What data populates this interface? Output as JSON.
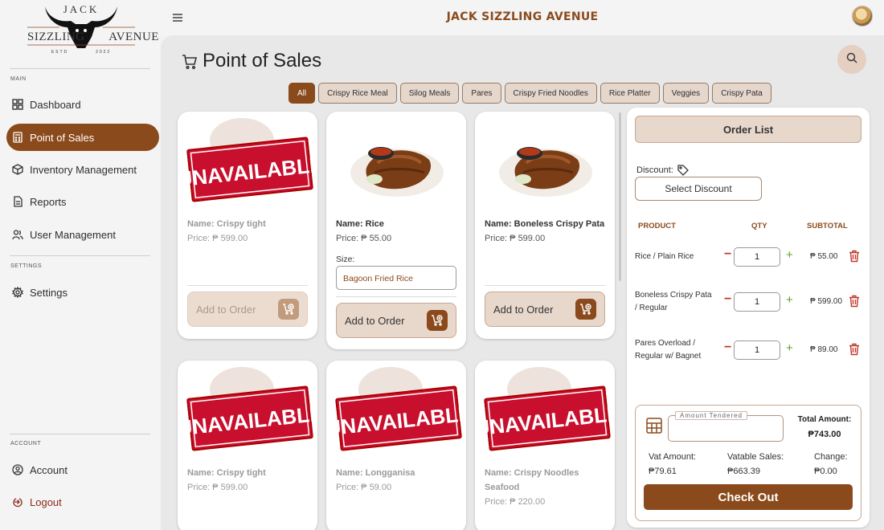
{
  "brand": {
    "logo_top": "JACK",
    "logo_mid_left": "SIZZLING",
    "logo_mid_right": "AVENUE",
    "logo_estd_left": "ESTD",
    "logo_estd_right": "2022",
    "title": "JACK SIZZLING AVENUE"
  },
  "sidebar": {
    "section_main": "MAIN",
    "section_settings": "SETTINGS",
    "section_account": "ACCOUNT",
    "items": [
      {
        "label": "Dashboard",
        "icon": "grid-icon"
      },
      {
        "label": "Point of Sales",
        "icon": "calculator-icon"
      },
      {
        "label": "Inventory Management",
        "icon": "box-icon"
      },
      {
        "label": "Reports",
        "icon": "document-icon"
      },
      {
        "label": "User Management",
        "icon": "users-icon"
      },
      {
        "label": "Settings",
        "icon": "gear-icon"
      },
      {
        "label": "Account",
        "icon": "user-circle-icon"
      },
      {
        "label": "Logout",
        "icon": "logout-icon"
      }
    ],
    "active": "Point of Sales"
  },
  "page": {
    "title": "Point of Sales"
  },
  "categories": [
    "All",
    "Crispy Rice Meal",
    "Silog Meals",
    "Pares",
    "Crispy Fried Noodles",
    "Rice Platter",
    "Veggies",
    "Crispy Pata"
  ],
  "active_category": "All",
  "products": [
    {
      "name": "Name: Crispy tight",
      "price": "Price: ₱ 599.00",
      "available": false,
      "button": "Add to Order"
    },
    {
      "name": "Name: Rice",
      "price": "Price: ₱ 55.00",
      "available": true,
      "size_label": "Size:",
      "size_value": "Bagoon Fried Rice",
      "button": "Add to Order"
    },
    {
      "name": "Name: Boneless Crispy Pata",
      "price": "Price: ₱ 599.00",
      "available": true,
      "button": "Add to Order"
    },
    {
      "name": "Name: Crispy tight",
      "price": "Price: ₱ 599.00",
      "available": false
    },
    {
      "name": "Name: Longganisa",
      "price": "Price: ₱ 59.00",
      "available": false
    },
    {
      "name": "Name: Crispy Noodles",
      "name2": "Seafood",
      "price": "Price: ₱ 220.00",
      "available": false
    }
  ],
  "unavailable_text": "UNAVAILABLE",
  "order": {
    "title": "Order List",
    "discount_label": "Discount:",
    "discount_button": "Select Discount",
    "headers": {
      "product": "PRODUCT",
      "qty": "QTY",
      "subtotal": "SUBTOTAL"
    },
    "items": [
      {
        "name": "Rice / Plain Rice",
        "qty": "1",
        "subtotal": "₱ 55.00"
      },
      {
        "name": "Boneless Crispy Pata / Regular",
        "qty": "1",
        "subtotal": "₱ 599.00"
      },
      {
        "name": "Pares Overload / Regular w/ Bagnet",
        "qty": "1",
        "subtotal": "₱ 89.00"
      }
    ],
    "amount_tendered_label": "Amount Tendered",
    "amount_tendered_value": "",
    "total_label": "Total Amount:",
    "total_value": "₱743.00",
    "vat_label": "Vat Amount:",
    "vat_value": "₱79.61",
    "vatable_label": "Vatable Sales:",
    "vatable_value": "₱663.39",
    "change_label": "Change:",
    "change_value": "₱0.00",
    "checkout": "Check Out"
  },
  "colors": {
    "accent": "#8b4a1c",
    "danger": "#c0392b",
    "plus": "#5aa02c"
  }
}
